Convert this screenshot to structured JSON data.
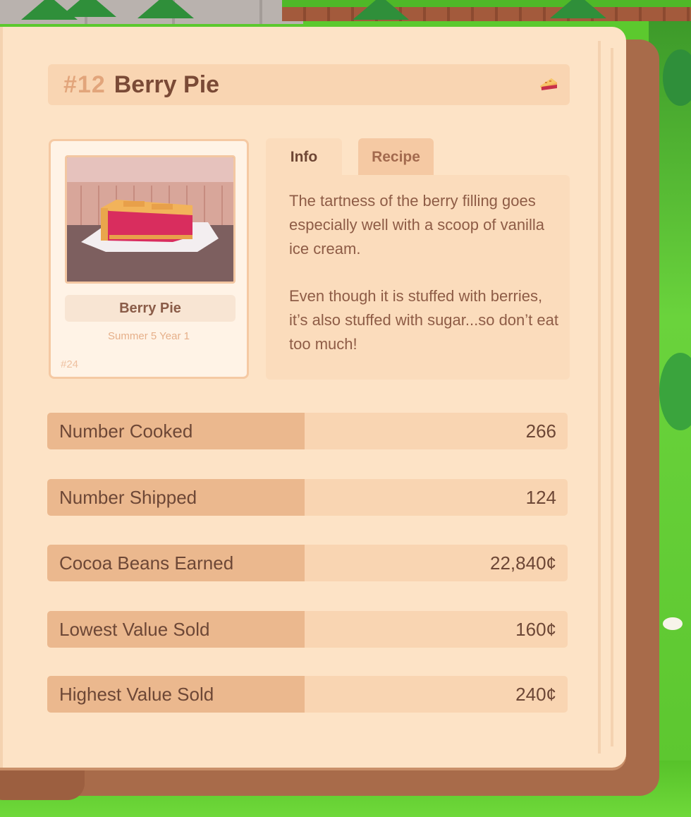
{
  "entry": {
    "number": "#12",
    "name": "Berry Pie",
    "icon": "pie-icon"
  },
  "card": {
    "name": "Berry Pie",
    "date": "Summer 5 Year 1",
    "number": "#24"
  },
  "tabs": [
    {
      "label": "Info",
      "active": true
    },
    {
      "label": "Recipe",
      "active": false
    }
  ],
  "description": {
    "paragraph_1": "The tartness of the berry filling goes especially well with a scoop of vanilla ice cream.",
    "paragraph_2": "Even though it is stuffed with berries, it’s also stuffed with sugar...so don’t eat too much!"
  },
  "stats": [
    {
      "label": "Number Cooked",
      "value": "266"
    },
    {
      "label": "Number Shipped",
      "value": "124"
    },
    {
      "label": "Cocoa Beans Earned",
      "value": "22,840¢"
    },
    {
      "label": "Lowest Value Sold",
      "value": "160¢"
    },
    {
      "label": "Highest Value Sold",
      "value": "240¢"
    }
  ],
  "colors": {
    "page": "#fde3c6",
    "book_cover": "#a86b4a",
    "label_fill": "#ebb88e",
    "text_dark": "#6d4736"
  }
}
